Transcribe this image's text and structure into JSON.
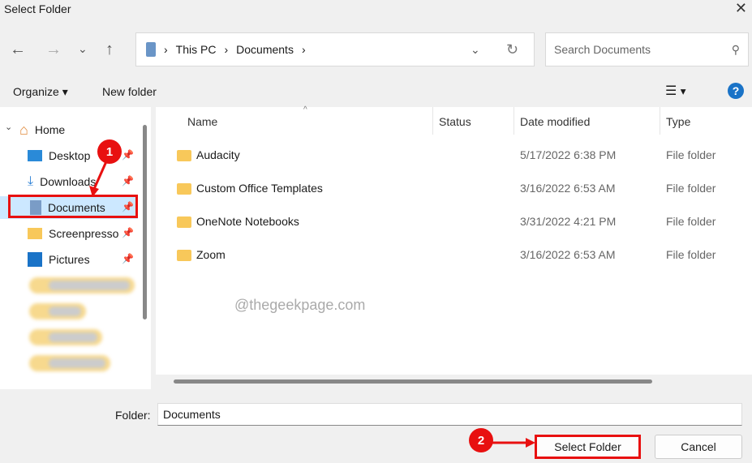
{
  "window": {
    "title": "Select Folder"
  },
  "address": {
    "segments": [
      "This PC",
      "Documents"
    ]
  },
  "search": {
    "placeholder": "Search Documents"
  },
  "toolbar": {
    "organize": "Organize",
    "new_folder": "New folder"
  },
  "sidebar": {
    "home": "Home",
    "items": [
      {
        "label": "Desktop",
        "icon": "desktop-icon"
      },
      {
        "label": "Downloads",
        "icon": "download-icon"
      },
      {
        "label": "Documents",
        "icon": "documents-icon",
        "selected": true
      },
      {
        "label": "Screenpresso",
        "icon": "folder-icon"
      },
      {
        "label": "Pictures",
        "icon": "pictures-icon"
      }
    ]
  },
  "columns": {
    "name": "Name",
    "status": "Status",
    "date": "Date modified",
    "type": "Type"
  },
  "files": [
    {
      "name": "Audacity",
      "date": "5/17/2022 6:38 PM",
      "type": "File folder"
    },
    {
      "name": "Custom Office Templates",
      "date": "3/16/2022 6:53 AM",
      "type": "File folder"
    },
    {
      "name": "OneNote Notebooks",
      "date": "3/31/2022 4:21 PM",
      "type": "File folder"
    },
    {
      "name": "Zoom",
      "date": "3/16/2022 6:53 AM",
      "type": "File folder"
    }
  ],
  "watermark": "@thegeekpage.com",
  "footer": {
    "folder_label": "Folder:",
    "folder_value": "Documents",
    "select": "Select Folder",
    "cancel": "Cancel"
  },
  "annotations": {
    "step1": "1",
    "step2": "2",
    "color": "#e81010"
  }
}
